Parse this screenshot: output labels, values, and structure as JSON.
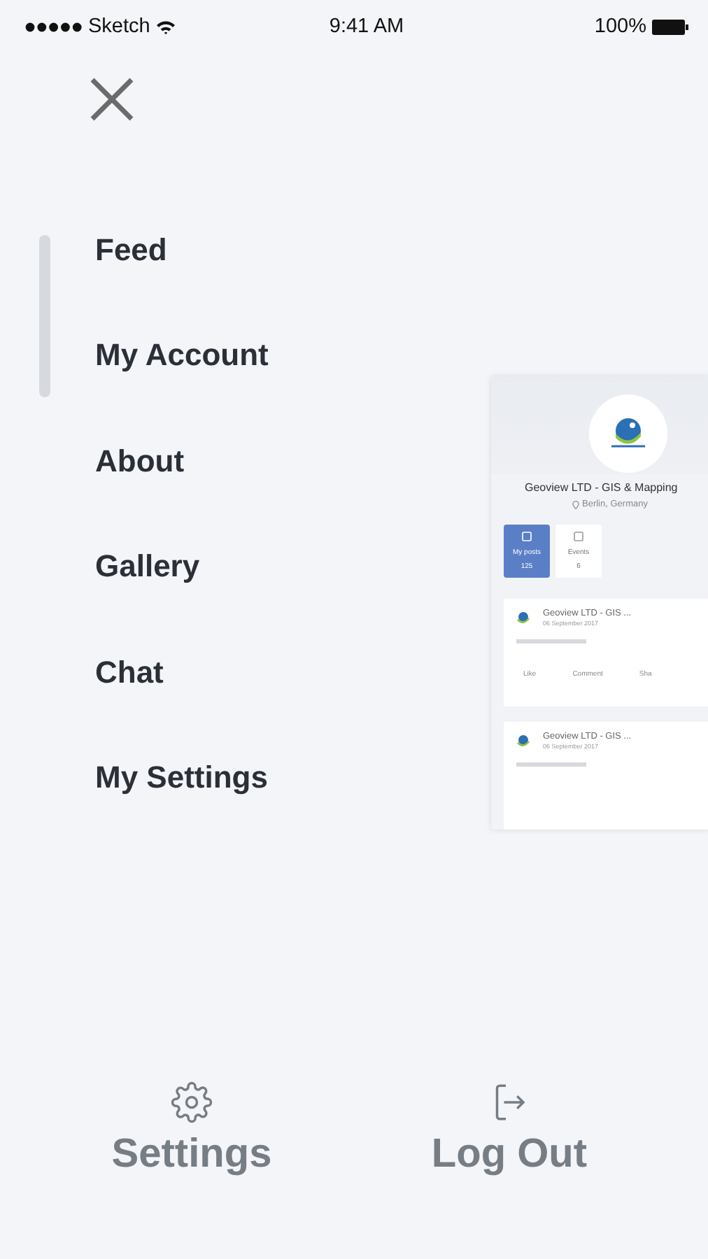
{
  "status_bar": {
    "carrier": "Sketch",
    "time": "9:41 AM",
    "battery": "100%"
  },
  "menu": {
    "items": [
      {
        "label": "Feed"
      },
      {
        "label": "My Account"
      },
      {
        "label": "About"
      },
      {
        "label": "Gallery"
      },
      {
        "label": "Chat"
      },
      {
        "label": "My Settings"
      }
    ]
  },
  "preview": {
    "title": "Geoview LTD - GIS & Mapping",
    "location": "Berlin, Germany",
    "tiles": [
      {
        "label": "My posts",
        "count": "125",
        "selected": true
      },
      {
        "label": "Events",
        "count": "6",
        "selected": false
      }
    ],
    "posts": [
      {
        "author": "Geoview LTD - GIS ...",
        "date": "06 September 2017",
        "actions": [
          "Like",
          "Comment",
          "Sha"
        ]
      },
      {
        "author": "Geoview LTD - GIS ...",
        "date": "06 September 2017"
      }
    ]
  },
  "footer": [
    {
      "kind": "gear",
      "label": "Settings"
    },
    {
      "kind": "logout",
      "label": "Log Out"
    }
  ]
}
